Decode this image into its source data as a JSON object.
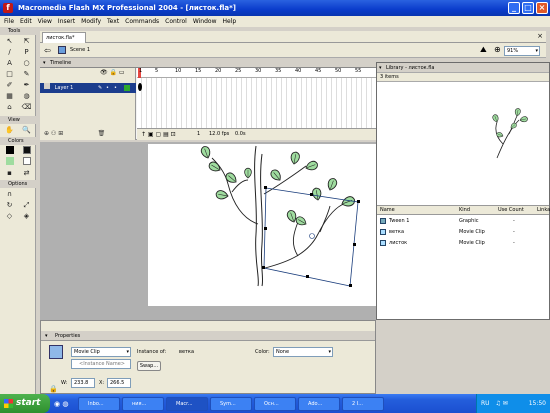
{
  "window": {
    "title": "Macromedia Flash MX Professional 2004 - [листок.fla*]"
  },
  "menu": [
    "File",
    "Edit",
    "View",
    "Insert",
    "Modify",
    "Text",
    "Commands",
    "Control",
    "Window",
    "Help"
  ],
  "tools": {
    "title": "Tools",
    "view_label": "View",
    "colors_label": "Colors",
    "options_label": "Options",
    "tool_glyphs": [
      "↖",
      "⇱",
      "/",
      "P",
      "A",
      "○",
      "□",
      "✎",
      "✐",
      "✒",
      "▦",
      "◍",
      "⌂",
      "⌫"
    ]
  },
  "document": {
    "tab": "листок.fla*",
    "scene": "Scene 1",
    "zoom": "91%"
  },
  "timeline": {
    "title": "Timeline",
    "layer": "Layer 1",
    "ruler": [
      "1",
      "5",
      "10",
      "15",
      "20",
      "25",
      "30",
      "35",
      "40",
      "45",
      "50",
      "55"
    ],
    "frame": "1",
    "fps": "12.0 fps",
    "time": "0.0s"
  },
  "library": {
    "title": "Library - листок.fla",
    "count": "3 items",
    "columns": {
      "name": "Name",
      "kind": "Kind",
      "use": "Use Count",
      "link": "Linka"
    },
    "items": [
      {
        "name": "Tween 1",
        "kind": "Graphic",
        "use": "-"
      },
      {
        "name": "ветка",
        "kind": "Movie Clip",
        "use": "-"
      },
      {
        "name": "листок",
        "kind": "Movie Clip",
        "use": "-"
      }
    ]
  },
  "properties": {
    "title": "Properties",
    "type": "Movie Clip",
    "instance_of_label": "Instance of:",
    "instance_of": "ветка",
    "instance_name_placeholder": "<Instance Name>",
    "swap": "Swap...",
    "color_label": "Color:",
    "color_value": "None",
    "w_label": "W:",
    "w": "233.8",
    "x_label": "X:",
    "x": "266.5"
  },
  "taskbar": {
    "start": "start",
    "items": [
      "Inbo...",
      "ния...",
      "Macr...",
      "Sym...",
      "Осн...",
      "Ado...",
      "2 I..."
    ],
    "lang": "RU",
    "clock": "15:50"
  },
  "colors": {
    "leaf": "#9fdc9f",
    "selection": "#1a3d7c"
  }
}
